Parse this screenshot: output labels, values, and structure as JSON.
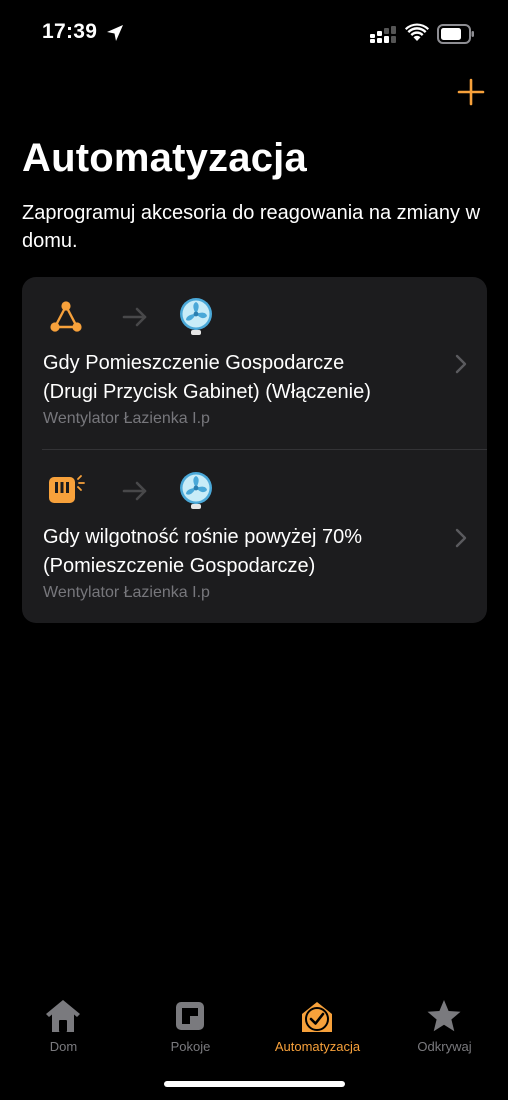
{
  "status": {
    "time": "17:39"
  },
  "header": {
    "add_icon": "plus-icon",
    "title": "Automatyzacja",
    "subtitle": "Zaprogramuj akcesoria do reagowania na zmiany w domu."
  },
  "automations": [
    {
      "trigger_icon": "accessory-trigger-icon",
      "target_icon": "fan-icon",
      "title_line1": "Gdy Pomieszczenie Gospodarcze",
      "title_line2": "(Drugi Przycisk Gabinet) (Włączenie)",
      "subtitle": "Wentylator Łazienka I.p"
    },
    {
      "trigger_icon": "humidity-sensor-icon",
      "target_icon": "fan-icon",
      "title_line1": "Gdy wilgotność rośnie powyżej 70%",
      "title_line2": "(Pomieszczenie Gospodarcze)",
      "subtitle": "Wentylator Łazienka I.p"
    }
  ],
  "tabs": [
    {
      "label": "Dom",
      "icon": "house-icon",
      "active": false
    },
    {
      "label": "Pokoje",
      "icon": "rooms-icon",
      "active": false
    },
    {
      "label": "Automatyzacja",
      "icon": "clock-house-icon",
      "active": true
    },
    {
      "label": "Odkrywaj",
      "icon": "star-icon",
      "active": false
    }
  ],
  "colors": {
    "accent": "#f7a13b",
    "background": "#000000",
    "card": "#1c1c1e",
    "fan_blue": "#4aa8d8"
  }
}
